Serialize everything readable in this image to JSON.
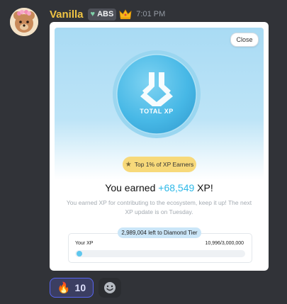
{
  "message": {
    "username": "Vanilla",
    "tag": "ABS",
    "timestamp": "7:01 PM"
  },
  "card": {
    "close_label": "Close",
    "coin_label": "TOTAL XP",
    "rank_badge": "Top 1% of XP Earners",
    "earned_prefix": "You earned ",
    "earned_amount": "+68,549",
    "earned_suffix": " XP!",
    "description": "You earned XP for contributing to the ecosystem, keep it up! The next XP update is on Tuesday.",
    "tier_progress_label": "2,989,004 left to Diamond Tier",
    "your_xp_label": "Your XP",
    "xp_value": "10,996/3,000,000",
    "xp_progress_fraction": 0.0037
  },
  "reactions": {
    "fire_emoji": "🔥",
    "fire_count": "10"
  },
  "colors": {
    "username": "#f0c444",
    "accent_blue": "#2eb9e8",
    "badge_gold": "#f7d97a",
    "reaction_border": "#5865f2"
  }
}
